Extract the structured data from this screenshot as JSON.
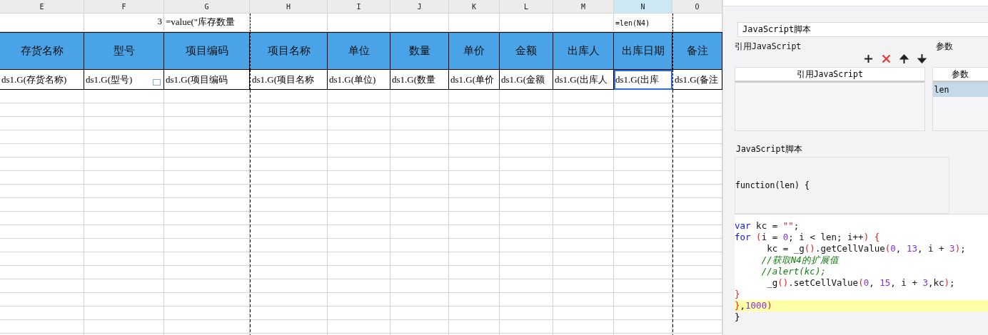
{
  "sheet": {
    "columns": [
      {
        "letter": "E",
        "header": "存货名称",
        "cell": "ds1.G(存货名称)",
        "selected": false
      },
      {
        "letter": "F",
        "formula": "3",
        "header": "型号",
        "cell": "ds1.G(型号)",
        "selected": false
      },
      {
        "letter": "G",
        "formula": "=value(\"库存数量",
        "header": "项目编码",
        "cell": "ds1.G(项目编码",
        "selected": false
      },
      {
        "letter": "H",
        "header": "项目名称",
        "cell": "ds1.G(项目名称",
        "selected": false
      },
      {
        "letter": "I",
        "header": "单位",
        "cell": "ds1.G(单位)",
        "selected": false
      },
      {
        "letter": "J",
        "header": "数量",
        "cell": "ds1.G(数量",
        "selected": false
      },
      {
        "letter": "K",
        "header": "单价",
        "cell": "ds1.G(单价",
        "selected": false
      },
      {
        "letter": "L",
        "header": "金额",
        "cell": "ds1.G(金额",
        "selected": false
      },
      {
        "letter": "M",
        "header": "出库人",
        "cell": "ds1.G(出库人",
        "selected": false
      },
      {
        "letter": "N",
        "formula": "=len(N4)",
        "header": "出库日期",
        "cell": "ds1.G(出库",
        "selected": true
      },
      {
        "letter": "O",
        "header": "备注",
        "cell": "ds1.G(备注",
        "selected": false
      }
    ]
  },
  "panel": {
    "event_field": {
      "value": "JavaScript脚本"
    },
    "reference_group": {
      "title": "引用JavaScript",
      "column": "引用JavaScript"
    },
    "params_group": {
      "title": "参数",
      "column": "参数",
      "rows": [
        {
          "name": "len",
          "selected": true
        }
      ]
    },
    "script_group": {
      "title": "JavaScript脚本",
      "signature": "function(len) {",
      "lines": [
        {
          "highlighted": false,
          "tokens": [
            {
              "kind": "keyword",
              "text": "var"
            },
            {
              "kind": "plain",
              "text": " kc = "
            },
            {
              "kind": "string",
              "text": "\"\""
            },
            {
              "kind": "plain",
              "text": ";"
            }
          ]
        },
        {
          "highlighted": false,
          "tokens": [
            {
              "kind": "keyword",
              "text": "for"
            },
            {
              "kind": "paren",
              "text": " ("
            },
            {
              "kind": "plain",
              "text": "i = "
            },
            {
              "kind": "number",
              "text": "0"
            },
            {
              "kind": "plain",
              "text": "; i < len; i++"
            },
            {
              "kind": "paren",
              "text": ") {"
            }
          ]
        },
        {
          "highlighted": false,
          "tokens": [
            {
              "kind": "plain",
              "text": "      kc = _g"
            },
            {
              "kind": "paren",
              "text": "()"
            },
            {
              "kind": "plain",
              "text": ".getCellValue"
            },
            {
              "kind": "paren",
              "text": "("
            },
            {
              "kind": "number",
              "text": "0"
            },
            {
              "kind": "plain",
              "text": ", "
            },
            {
              "kind": "number",
              "text": "13"
            },
            {
              "kind": "plain",
              "text": ", i + "
            },
            {
              "kind": "number",
              "text": "3"
            },
            {
              "kind": "paren",
              "text": ")"
            },
            {
              "kind": "plain",
              "text": ";"
            }
          ]
        },
        {
          "highlighted": false,
          "tokens": [
            {
              "kind": "comment",
              "text": "     //获取N4的扩展值"
            }
          ]
        },
        {
          "highlighted": false,
          "tokens": [
            {
              "kind": "comment",
              "text": "     //alert(kc);"
            }
          ]
        },
        {
          "highlighted": false,
          "tokens": [
            {
              "kind": "plain",
              "text": "      _g"
            },
            {
              "kind": "paren",
              "text": "()"
            },
            {
              "kind": "plain",
              "text": ".setCellValue"
            },
            {
              "kind": "paren",
              "text": "("
            },
            {
              "kind": "number",
              "text": "0"
            },
            {
              "kind": "plain",
              "text": ", "
            },
            {
              "kind": "number",
              "text": "15"
            },
            {
              "kind": "plain",
              "text": ", i + "
            },
            {
              "kind": "number",
              "text": "3"
            },
            {
              "kind": "plain",
              "text": ",kc"
            },
            {
              "kind": "paren",
              "text": ")"
            },
            {
              "kind": "plain",
              "text": ";"
            }
          ]
        },
        {
          "highlighted": false,
          "tokens": [
            {
              "kind": "paren",
              "text": "}"
            }
          ]
        },
        {
          "highlighted": true,
          "tokens": [
            {
              "kind": "paren",
              "text": "}"
            },
            {
              "kind": "plain",
              "text": ","
            },
            {
              "kind": "number",
              "text": "1000"
            },
            {
              "kind": "paren",
              "text": ")"
            }
          ]
        }
      ],
      "closing": "}"
    }
  }
}
